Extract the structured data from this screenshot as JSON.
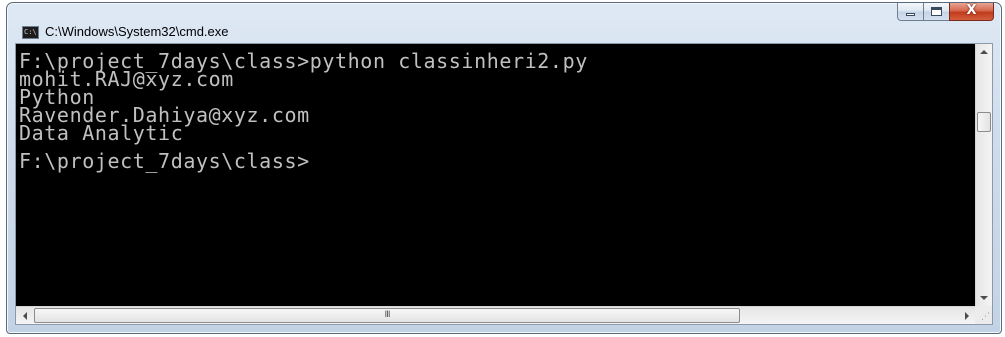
{
  "window": {
    "title": "C:\\Windows\\System32\\cmd.exe",
    "icon": "cmd-console-icon",
    "icon_text": "C:\\",
    "controls": {
      "minimize_icon": "minimize-icon",
      "maximize_icon": "maximize-icon",
      "close_icon": "close-icon",
      "close_glyph": "X"
    }
  },
  "console": {
    "command_line": "F:\\project_7days\\class>python classinheri2.py",
    "output_lines": [
      "mohit.RAJ@xyz.com",
      "Python",
      "Ravender.Dahiya@xyz.com",
      "Data Analytic"
    ],
    "prompt": "F:\\project_7days\\class>",
    "colors": {
      "background": "#000000",
      "text": "#c0c0c0"
    }
  },
  "scrollbars": {
    "horizontal_grip": "III",
    "resize_grip": "⋰"
  }
}
